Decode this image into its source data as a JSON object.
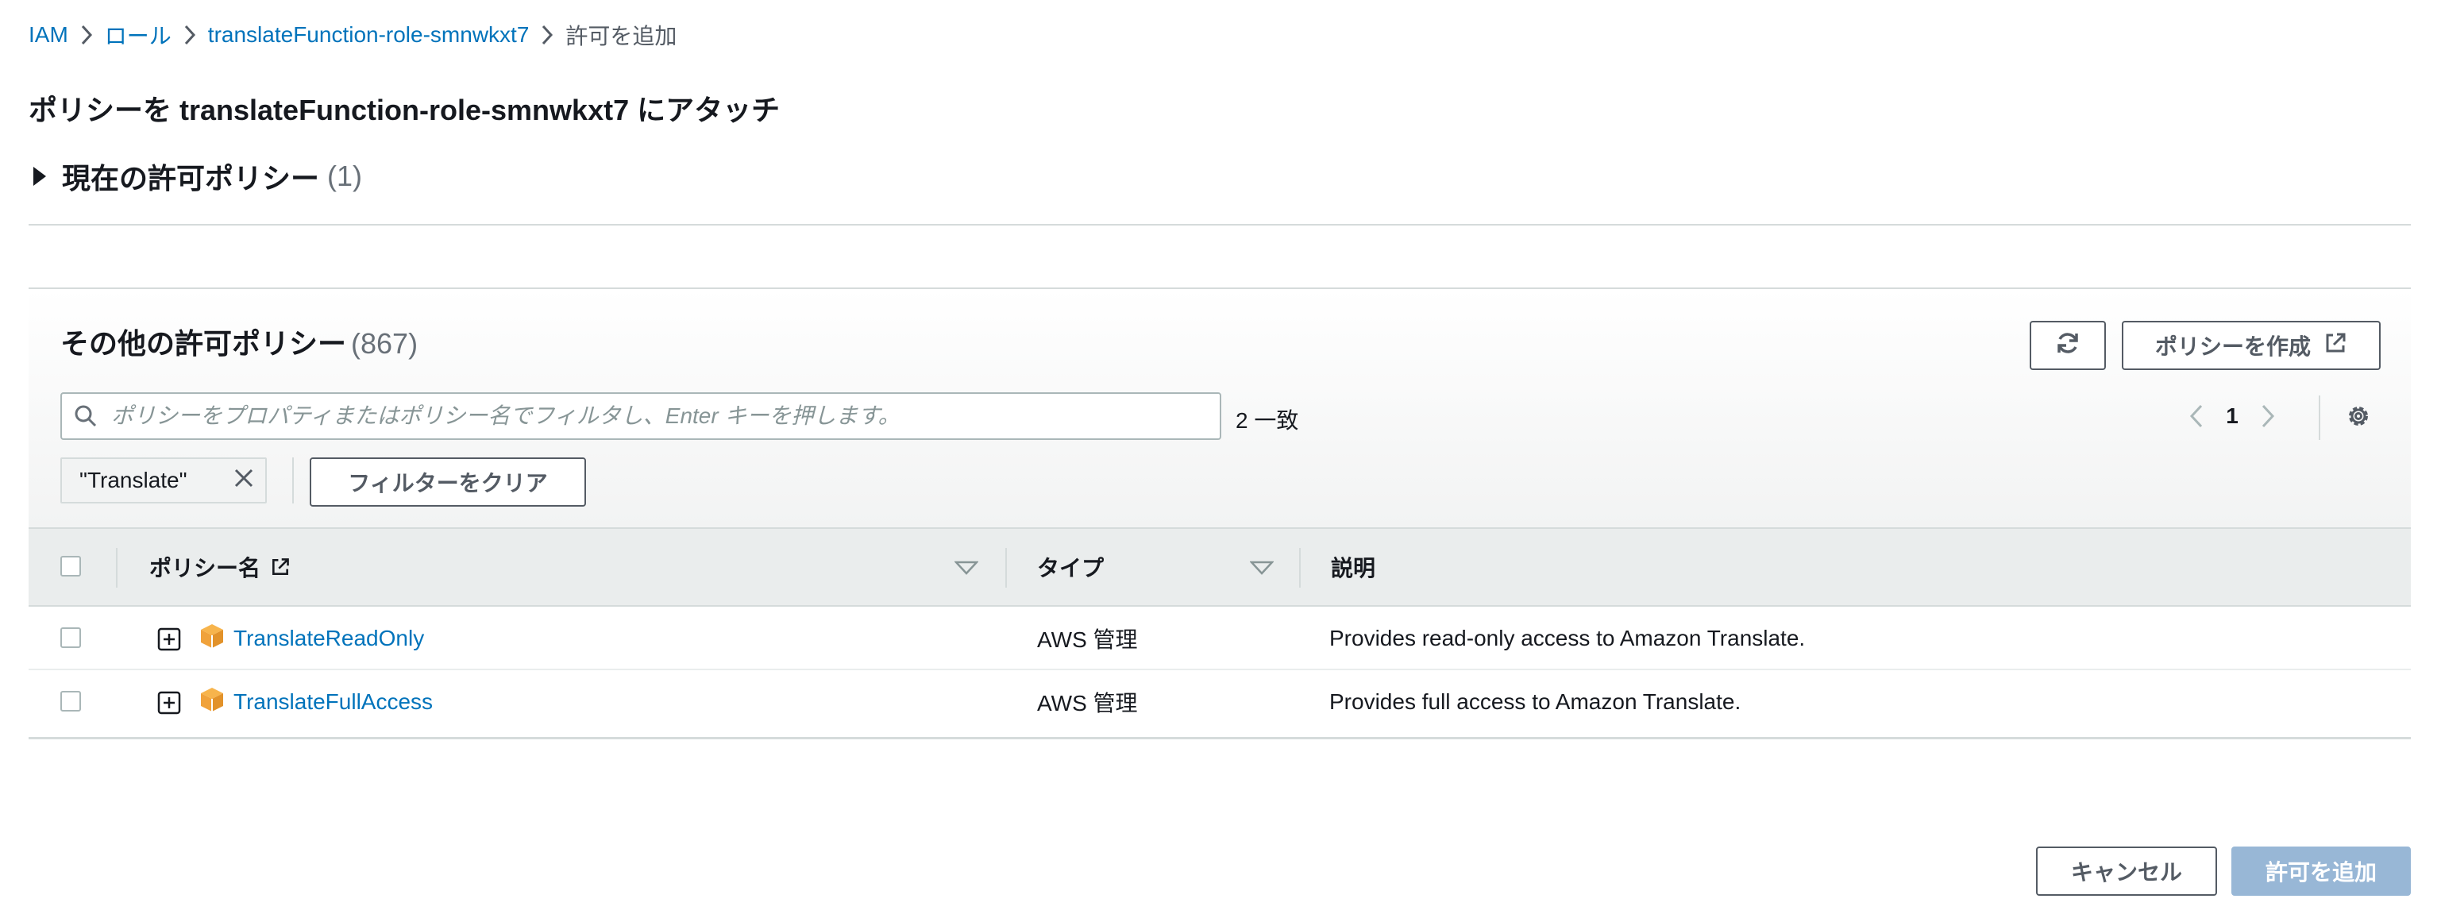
{
  "breadcrumb": {
    "items": [
      "IAM",
      "ロール",
      "translateFunction-role-smnwkxt7"
    ],
    "current": "許可を追加"
  },
  "page": {
    "title": "ポリシーを translateFunction-role-smnwkxt7 にアタッチ"
  },
  "current_policies": {
    "label": "現在の許可ポリシー",
    "count": "(1)"
  },
  "other_policies": {
    "label": "その他の許可ポリシー",
    "count": "(867)",
    "create_button": "ポリシーを作成",
    "search": {
      "placeholder": "ポリシーをプロパティまたはポリシー名でフィルタし、Enter キーを押します。",
      "value": ""
    },
    "match_count": "2 一致",
    "pagination": {
      "current_page": "1"
    },
    "filter_token": "\"Translate\"",
    "clear_filter_button": "フィルターをクリア",
    "columns": [
      "ポリシー名",
      "タイプ",
      "説明"
    ],
    "rows": [
      {
        "name": "TranslateReadOnly",
        "type": "AWS 管理",
        "description": "Provides read-only access to Amazon Translate."
      },
      {
        "name": "TranslateFullAccess",
        "type": "AWS 管理",
        "description": "Provides full access to Amazon Translate."
      }
    ]
  },
  "footer": {
    "cancel_button": "キャンセル",
    "add_button": "許可を追加"
  },
  "colors": {
    "link": "#0073bb",
    "primary_disabled": "#98b7d6",
    "policy_icon": "#f0a23b"
  },
  "icons": [
    "chevron-right-icon",
    "caret-right-icon",
    "refresh-icon",
    "external-link-icon",
    "search-icon",
    "chevron-left-icon",
    "settings-icon",
    "close-icon",
    "sort-down-icon",
    "expand-plus-icon",
    "aws-policy-cube-icon"
  ]
}
